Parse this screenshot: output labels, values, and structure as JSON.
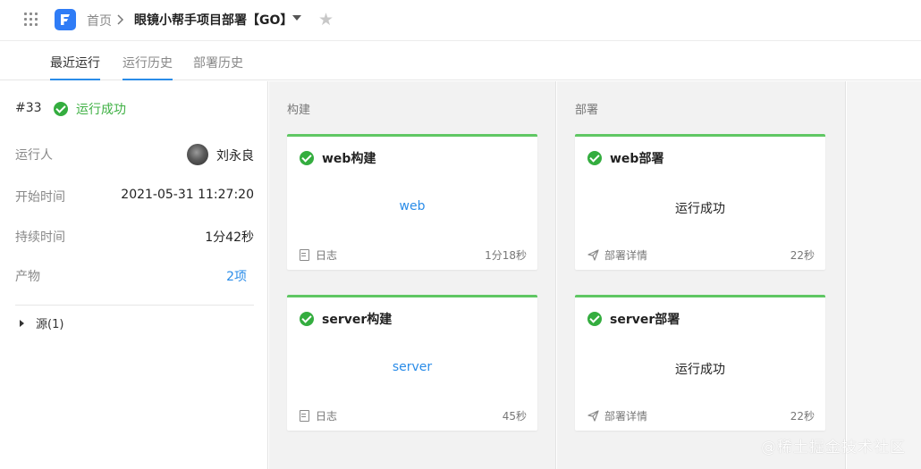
{
  "header": {
    "home_label": "首页",
    "project_title": "眼镜小帮手项目部署【GO】"
  },
  "tabs": [
    {
      "label": "最近运行",
      "active": true
    },
    {
      "label": "运行历史",
      "active": false
    },
    {
      "label": "部署历史",
      "active": false
    }
  ],
  "run": {
    "number": "#33",
    "status": "运行成功",
    "runner_label": "运行人",
    "runner_name": "刘永良",
    "start_label": "开始时间",
    "start_time": "2021-05-31 11:27:20",
    "duration_label": "持续时间",
    "duration": "1分42秒",
    "artifacts_label": "产物",
    "artifacts_value": "2项",
    "source_label": "源(1)"
  },
  "stages": {
    "build": {
      "title": "构建",
      "cards": [
        {
          "name": "web构建",
          "body": "web",
          "footer_label": "日志",
          "duration": "1分18秒"
        },
        {
          "name": "server构建",
          "body": "server",
          "footer_label": "日志",
          "duration": "45秒"
        }
      ]
    },
    "deploy": {
      "title": "部署",
      "cards": [
        {
          "name": "web部署",
          "body": "运行成功",
          "footer_label": "部署详情",
          "duration": "22秒"
        },
        {
          "name": "server部署",
          "body": "运行成功",
          "footer_label": "部署详情",
          "duration": "22秒"
        }
      ]
    }
  },
  "watermark": "@稀土掘金技术社区",
  "colors": {
    "accent": "#2a8ce8",
    "success": "#34ad3f",
    "card_top": "#5fc763",
    "logo": "#2f7cf6"
  },
  "icons": {
    "apps": "grid-dots-icon",
    "logo": "app-logo-icon",
    "star": "star-icon",
    "status": "check-circle-icon",
    "log": "document-icon",
    "deploy_detail": "paper-plane-icon"
  }
}
